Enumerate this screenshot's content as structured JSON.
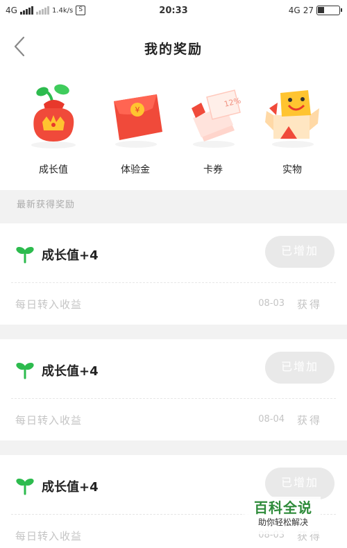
{
  "status_bar": {
    "network_left": "4G",
    "network_speed": "1.4k/s",
    "time": "20:33",
    "network_right": "4G",
    "battery": "27"
  },
  "header": {
    "title": "我的奖励"
  },
  "categories": [
    {
      "label": "成长值",
      "icon": "growth-bag-icon"
    },
    {
      "label": "体验金",
      "icon": "red-envelope-icon"
    },
    {
      "label": "卡券",
      "icon": "coupon-icon"
    },
    {
      "label": "实物",
      "icon": "gift-box-icon"
    }
  ],
  "section": {
    "label": "最新获得奖励"
  },
  "rewards": [
    {
      "title": "成长值+4",
      "status": "已增加",
      "desc": "每日转入收益",
      "date": "08-03",
      "got": "获得"
    },
    {
      "title": "成长值+4",
      "status": "已增加",
      "desc": "每日转入收益",
      "date": "08-04",
      "got": "获得"
    },
    {
      "title": "成长值+4",
      "status": "已增加",
      "desc": "每日转入收益",
      "date": "08-03",
      "got": "获得"
    }
  ],
  "watermark": {
    "title": "百科全说",
    "subtitle": "助你轻松解决"
  },
  "colors": {
    "accent_green": "#2dbb4e",
    "red": "#f04a3a",
    "disabled_button": "#e9e9e9"
  }
}
